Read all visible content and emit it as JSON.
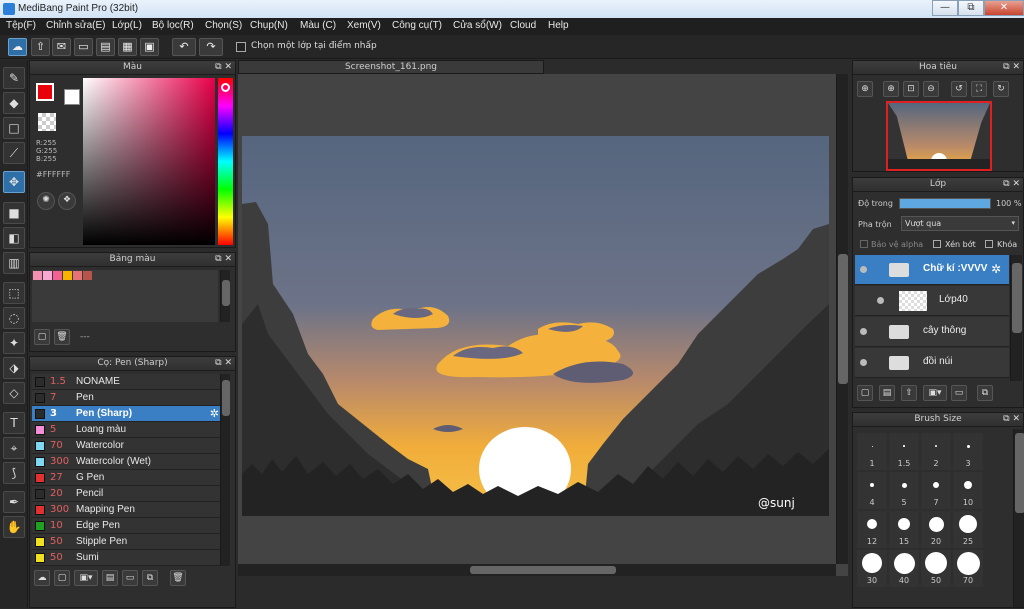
{
  "window": {
    "title": "MediBang Paint Pro (32bit)",
    "minimize": "—",
    "restore": "⧉",
    "close": "✕"
  },
  "menu": [
    "Tệp(F)",
    "Chỉnh sửa(E)",
    "Lớp(L)",
    "Bộ lọc(R)",
    "Chọn(S)",
    "Chụp(N)",
    "Màu (C)",
    "Xem(V)",
    "Công cụ(T)",
    "Cửa sổ(W)",
    "Cloud",
    "Help"
  ],
  "toolbar": {
    "select_layer_label": "Chọn một lớp tại điểm nhấp"
  },
  "color_panel": {
    "title": "Màu",
    "r": "R:255",
    "g": "G:255",
    "b": "B:255",
    "hex": "#FFFFFF"
  },
  "palette_panel": {
    "title": "Bảng màu",
    "swatches": [
      "#f48fb1",
      "#f9a8d4",
      "#f06292",
      "#f4b400",
      "#e57373",
      "#b5544b"
    ],
    "more": "---"
  },
  "brush_panel": {
    "title": "Cọ: Pen (Sharp)",
    "items": [
      {
        "size": "1.5",
        "name": "NONAME",
        "color": "#2b2b2b"
      },
      {
        "size": "7",
        "name": "Pen",
        "color": "#2b2b2b"
      },
      {
        "size": "3",
        "name": "Pen (Sharp)",
        "color": "#2b2b2b"
      },
      {
        "size": "5",
        "name": "Loang màu",
        "color": "#f48fd8"
      },
      {
        "size": "70",
        "name": "Watercolor",
        "color": "#7fd8f0"
      },
      {
        "size": "300",
        "name": "Watercolor (Wet)",
        "color": "#7fd8f0"
      },
      {
        "size": "27",
        "name": "G Pen",
        "color": "#e03030"
      },
      {
        "size": "20",
        "name": "Pencil",
        "color": "#2b2b2b"
      },
      {
        "size": "300",
        "name": "Mapping Pen",
        "color": "#e03030"
      },
      {
        "size": "10",
        "name": "Edge Pen",
        "color": "#20a020"
      },
      {
        "size": "50",
        "name": "Stipple Pen",
        "color": "#f0e020"
      },
      {
        "size": "50",
        "name": "Sumi",
        "color": "#f0e020"
      }
    ]
  },
  "canvas": {
    "tab": "Screenshot_161.png",
    "signature": "@sunj"
  },
  "navigator": {
    "title": "Hoa tiêu"
  },
  "layers": {
    "title": "Lớp",
    "opacity_label": "Độ trong",
    "opacity_value": "100 %",
    "opacity_fraction": 1.0,
    "blend_label": "Pha trộn",
    "blend_value": "Vượt qua",
    "protect_alpha": "Bảo vệ alpha",
    "clipping": "Xén bớt",
    "lock": "Khóa",
    "items": [
      {
        "name": "Chữ kí :VVVV",
        "type": "folder",
        "selected": true
      },
      {
        "name": "Lớp40",
        "type": "layer",
        "selected": false
      },
      {
        "name": "cây thông",
        "type": "folder",
        "selected": false
      },
      {
        "name": "đồi núi",
        "type": "folder",
        "selected": false
      }
    ]
  },
  "brush_size": {
    "title": "Brush Size",
    "sizes": [
      "1",
      "1.5",
      "2",
      "3",
      "4",
      "5",
      "7",
      "10",
      "12",
      "15",
      "20",
      "25",
      "30",
      "40",
      "50",
      "70"
    ]
  },
  "colors": {
    "accent": "#3a7fc4",
    "foreground": "#e8000b",
    "background": "#ffffff"
  }
}
